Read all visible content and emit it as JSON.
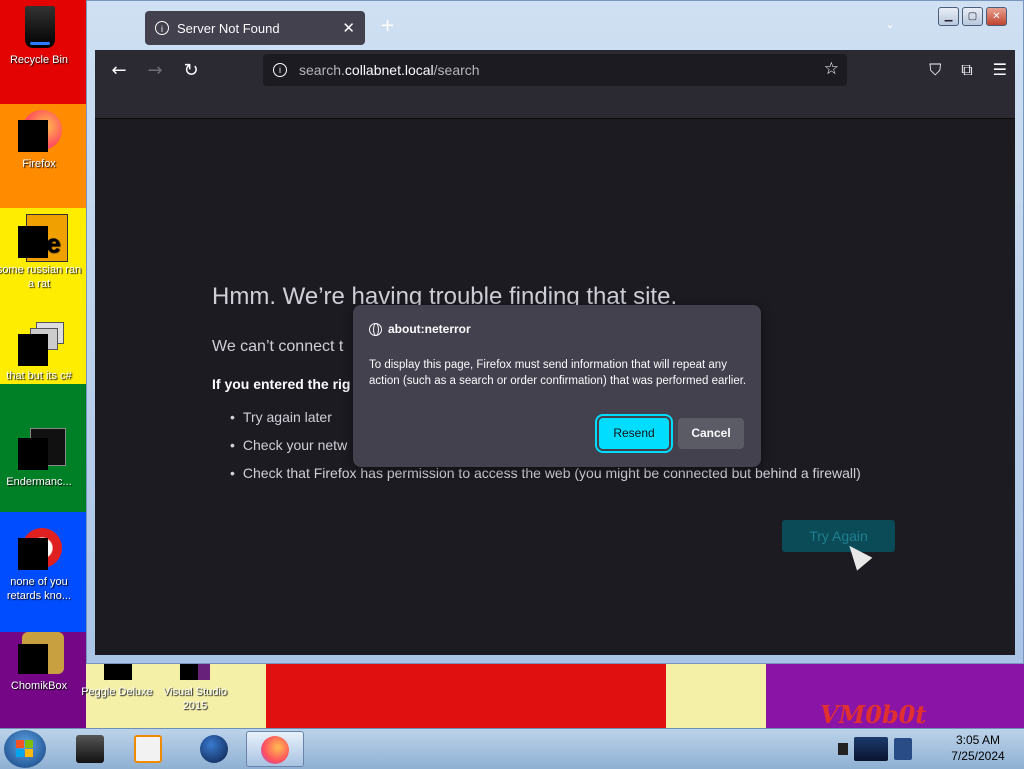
{
  "desktop": {
    "icons": [
      {
        "label": "Recycle Bin"
      },
      {
        "label": "Firefox"
      },
      {
        "label": "some russian ran a rat"
      },
      {
        "label": "that but its c#"
      },
      {
        "label": "Endermanc..."
      },
      {
        "label": "none of you retards kno..."
      },
      {
        "label": "ChomikBox"
      },
      {
        "label": "Peggle Deluxe"
      },
      {
        "label": "Visual Studio 2015"
      }
    ],
    "watermark": "VM0b0t"
  },
  "browser": {
    "tab": {
      "title": "Server Not Found",
      "close": "✕"
    },
    "new_tab": "+",
    "list_tabs": "⌄",
    "window_controls": {
      "minimize": "▁",
      "maximize": "▢",
      "close": "✕"
    },
    "url": {
      "scheme_host": "search.",
      "host": "collabnet.local",
      "path": "/search"
    },
    "toolbar_icons": [
      "back-icon",
      "forward-icon",
      "reload-icon",
      "pocket-icon",
      "extensions-icon",
      "menu-icon"
    ]
  },
  "error_page": {
    "title": "Hmm. We’re having trouble finding that site.",
    "subtitle": "We can’t connect t",
    "bold": "If you entered the rig",
    "list": [
      "Try again later",
      "Check your netw",
      "Check that Firefox has permission to access the web (you might be connected but behind a firewall)"
    ],
    "try_again": "Try Again"
  },
  "dialog": {
    "origin": "about:neterror",
    "message": "To display this page, Firefox must send information that will repeat any action (such as a search or order confirmation) that was performed earlier.",
    "resend": "Resend",
    "cancel": "Cancel"
  },
  "taskbar": {
    "time": "3:05 AM",
    "date": "7/25/2024"
  }
}
